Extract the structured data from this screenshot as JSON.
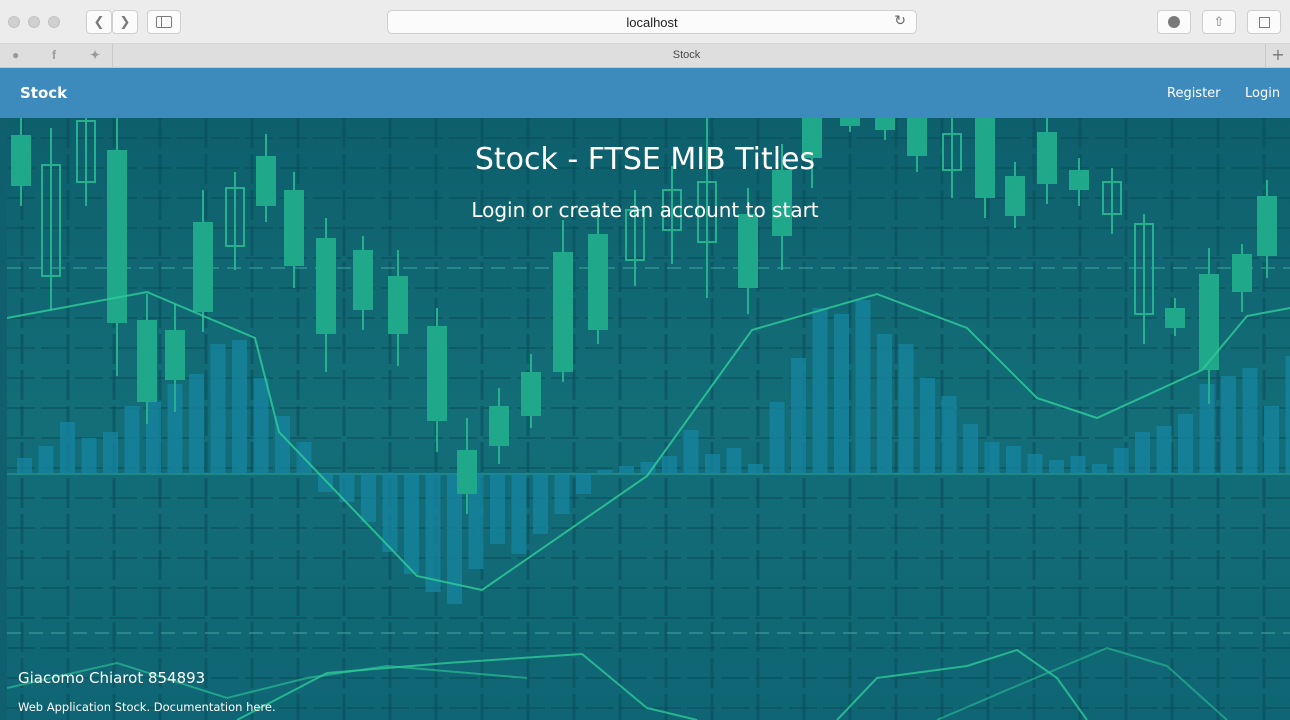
{
  "browser": {
    "address": "localhost",
    "tab_title": "Stock",
    "icons": [
      "back-icon",
      "forward-icon",
      "sidebar-icon",
      "reload-icon",
      "download-icon",
      "share-icon",
      "tabs-icon",
      "apple-icon",
      "facebook-icon",
      "twitter-icon",
      "plus-icon"
    ]
  },
  "navbar": {
    "brand": "Stock",
    "register": "Register",
    "login": "Login",
    "color": "#3d8bbd"
  },
  "hero": {
    "title": "Stock - FTSE MIB Titles",
    "subtitle": "Login or create an account to start"
  },
  "footer": {
    "author": "Giacomo Chiarot 854893",
    "doc": "Web Application Stock. Documentation here."
  },
  "colors": {
    "candle": "#1fa98a",
    "background": "#0f5f6e"
  }
}
